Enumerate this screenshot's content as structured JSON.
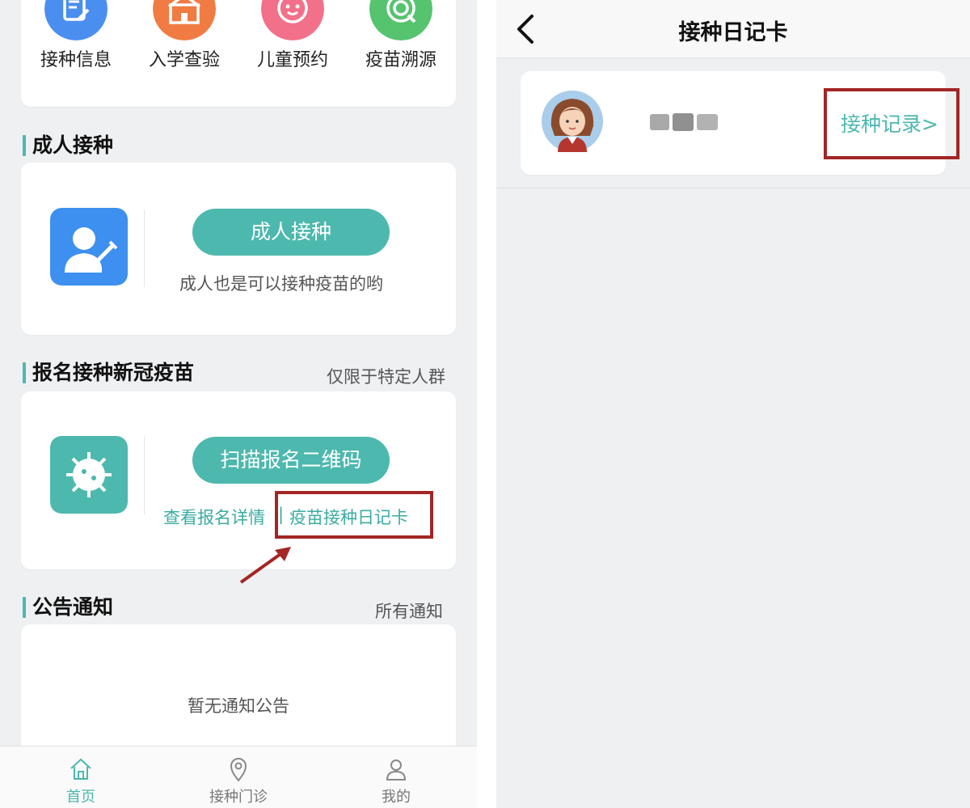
{
  "left": {
    "quick_items": [
      {
        "label": "接种信息",
        "icon": "document-edit-icon",
        "color": "#4a8ff0"
      },
      {
        "label": "入学查验",
        "icon": "school-icon",
        "color": "#f07c43"
      },
      {
        "label": "儿童预约",
        "icon": "baby-face-icon",
        "color": "#f3708a"
      },
      {
        "label": "疫苗溯源",
        "icon": "trace-icon",
        "color": "#56c36f"
      }
    ],
    "adult_section": {
      "title": "成人接种",
      "button_label": "成人接种",
      "hint": "成人也是可以接种疫苗的哟",
      "icon": "doctor-syringe-icon"
    },
    "covid_section": {
      "title": "报名接种新冠疫苗",
      "aside": "仅限于特定人群",
      "button_label": "扫描报名二维码",
      "details_link": "查看报名详情",
      "separator": "|",
      "diary_link": "疫苗接种日记卡",
      "icon": "virus-icon"
    },
    "notice_section": {
      "title": "公告通知",
      "aside": "所有通知",
      "empty_text": "暂无通知公告"
    },
    "bottom_nav": [
      {
        "label": "首页",
        "icon": "home-icon",
        "active": true
      },
      {
        "label": "接种门诊",
        "icon": "location-pin-icon",
        "active": false
      },
      {
        "label": "我的",
        "icon": "user-icon",
        "active": false
      }
    ]
  },
  "right": {
    "title": "接种日记卡",
    "record_link": "接种记录>"
  },
  "colors": {
    "accent": "#4db8ae",
    "highlight": "#a32525",
    "background": "#eef0f2"
  }
}
